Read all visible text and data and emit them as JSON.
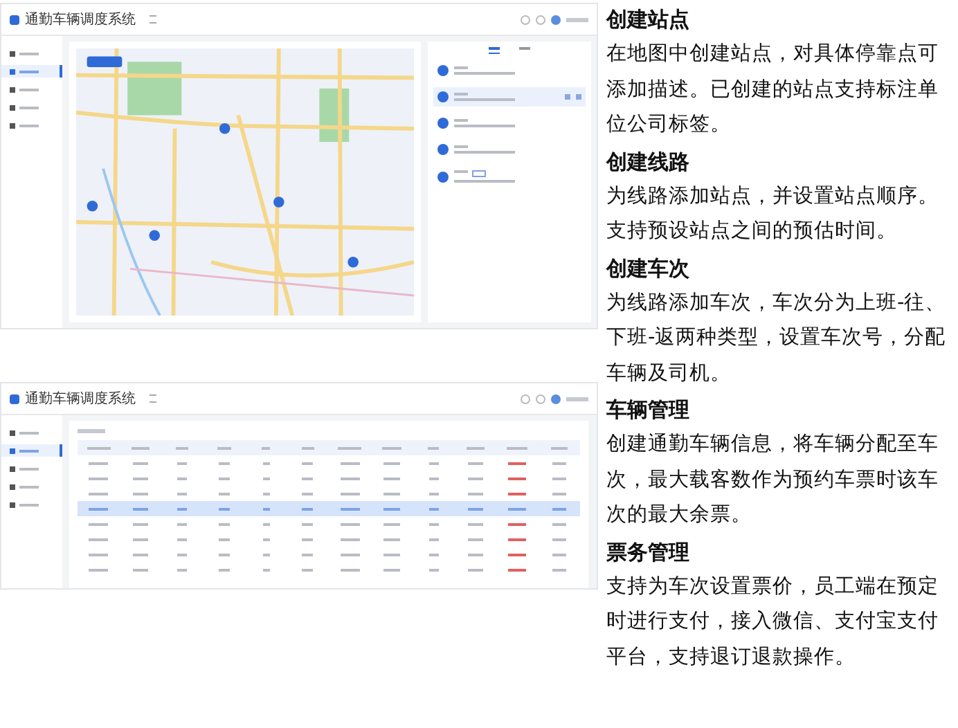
{
  "map_screenshot": {
    "app_name": "通勤车辆调度系统",
    "sidebar_items": [
      {
        "selected": false
      },
      {
        "selected": true
      },
      {
        "selected": false
      },
      {
        "selected": false
      },
      {
        "selected": false
      }
    ],
    "tabs": [
      {
        "selected": true
      },
      {
        "selected": false
      }
    ],
    "stations": [
      {
        "selected": false,
        "tagged": false
      },
      {
        "selected": true,
        "tagged": false
      },
      {
        "selected": false,
        "tagged": false
      },
      {
        "selected": false,
        "tagged": false
      },
      {
        "selected": false,
        "tagged": true
      }
    ]
  },
  "table_screenshot": {
    "app_name": "通勤车辆调度系统",
    "sidebar_items": [
      {
        "selected": false
      },
      {
        "selected": true
      },
      {
        "selected": false
      },
      {
        "selected": false
      },
      {
        "selected": false
      }
    ],
    "rows": [
      {
        "selected": false
      },
      {
        "selected": false
      },
      {
        "selected": false
      },
      {
        "selected": true
      },
      {
        "selected": false
      },
      {
        "selected": false
      },
      {
        "selected": false
      },
      {
        "selected": false
      }
    ]
  },
  "sections": [
    {
      "heading": "创建站点",
      "body": "在地图中创建站点，对具体停靠点可添加描述。已创建的站点支持标注单位公司标签。"
    },
    {
      "heading": "创建线路",
      "body": "为线路添加站点，并设置站点顺序。支持预设站点之间的预估时间。"
    },
    {
      "heading": "创建车次",
      "body": "为线路添加车次，车次分为上班-往、下班-返两种类型，设置车次号，分配车辆及司机。"
    },
    {
      "heading": "车辆管理",
      "body": "创建通勤车辆信息，将车辆分配至车次，最大载客数作为预约车票时该车次的最大余票。"
    },
    {
      "heading": "票务管理",
      "body": "支持为车次设置票价，员工端在预定时进行支付，接入微信、支付宝支付平台，支持退订退款操作。"
    }
  ]
}
